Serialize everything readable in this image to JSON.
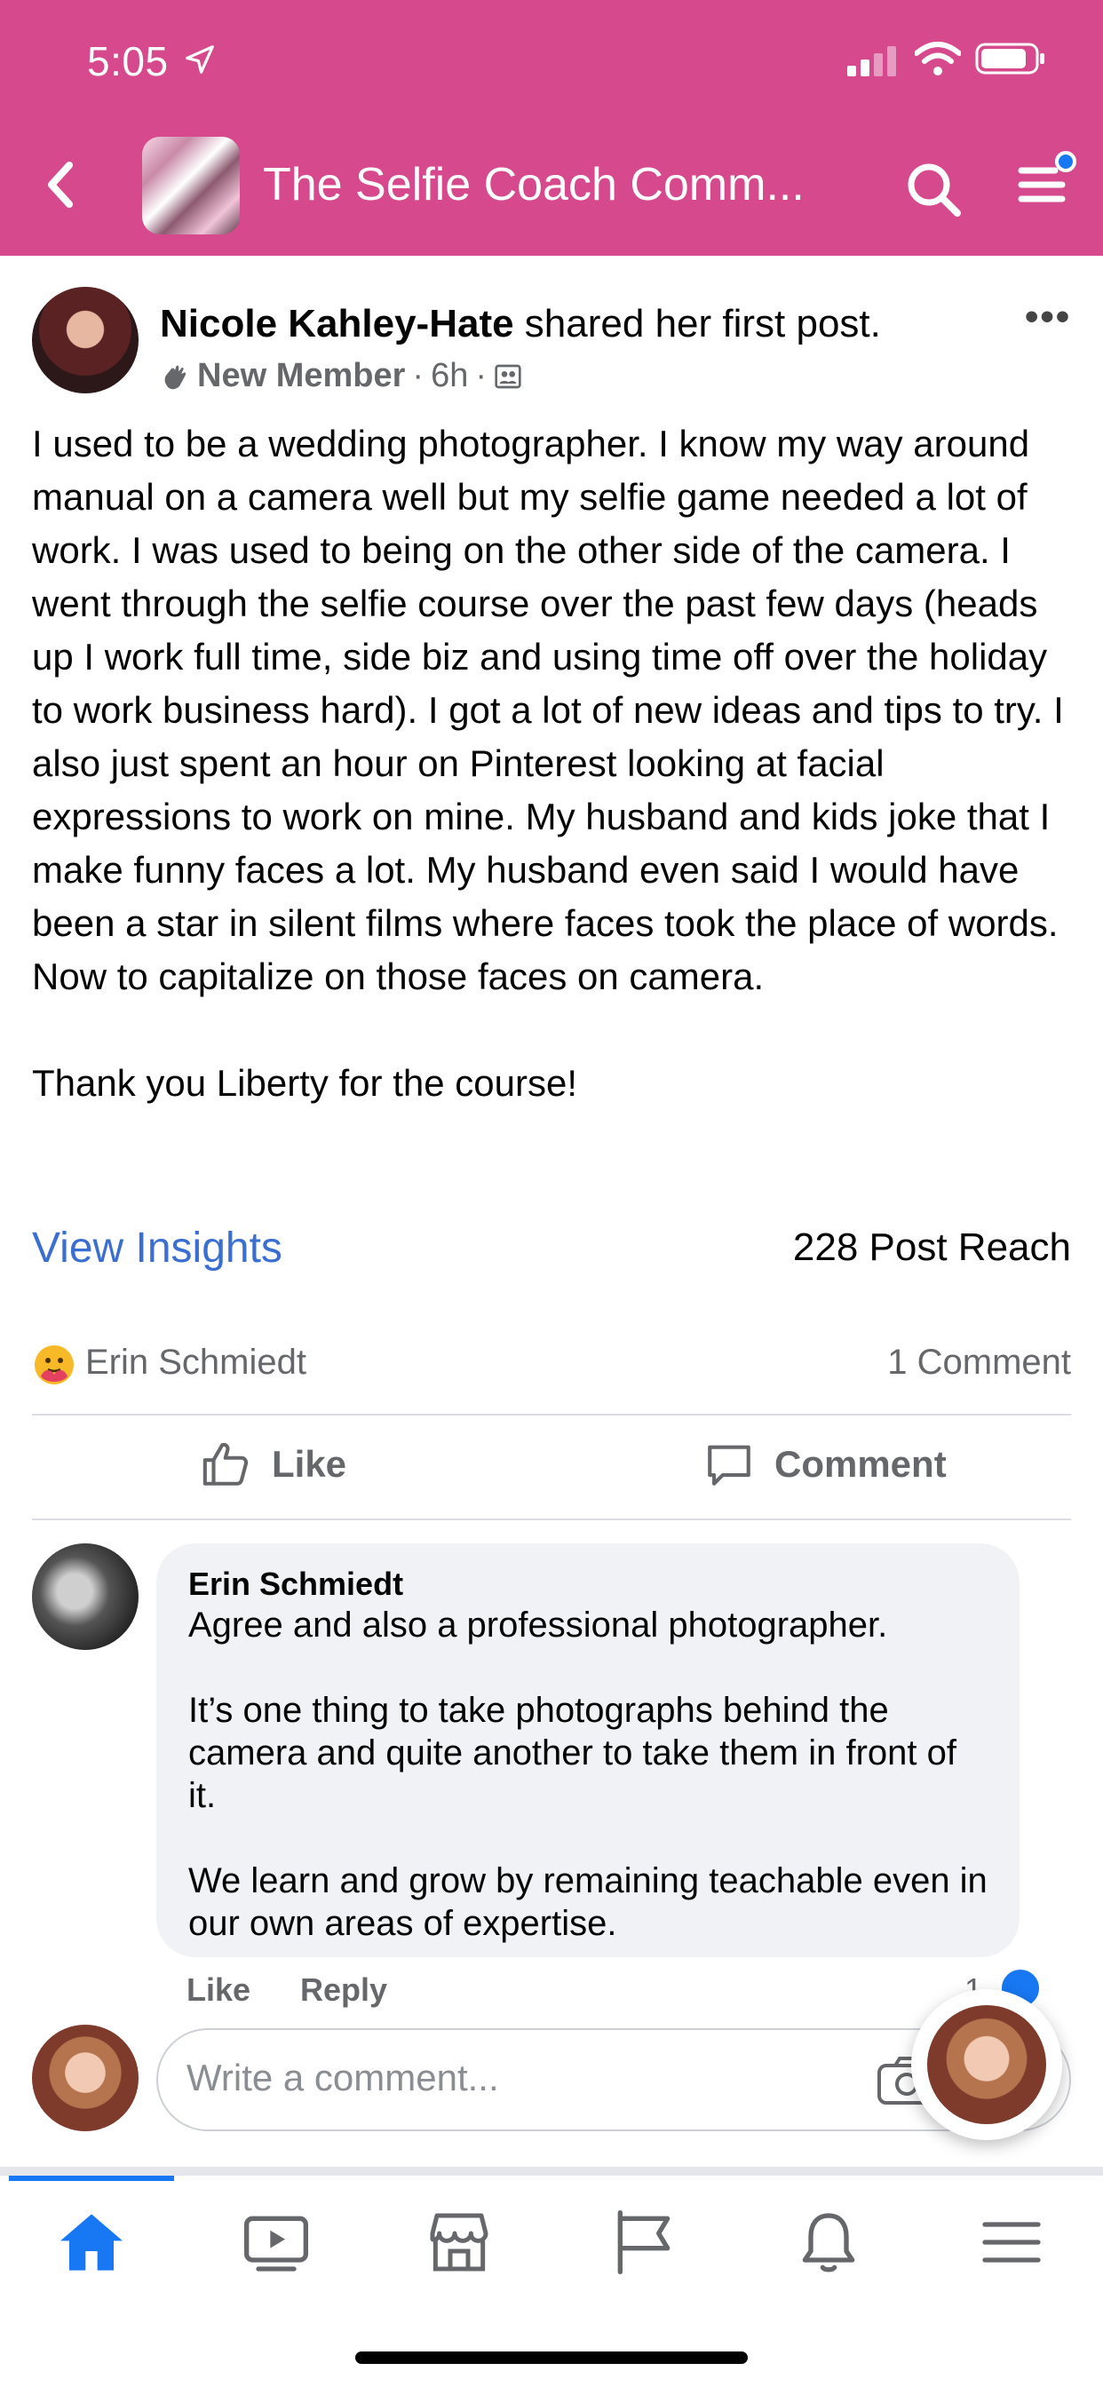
{
  "status_bar": {
    "time": "5:05",
    "icons": [
      "location-arrow-icon",
      "cell-signal-icon",
      "wifi-icon",
      "battery-icon"
    ]
  },
  "header": {
    "title": "The Selfie Coach Comm...",
    "background_color": "#d6498d",
    "icons": [
      "back-chevron-icon",
      "search-icon",
      "menu-icon"
    ]
  },
  "post": {
    "author": "Nicole Kahley-Hate",
    "action": " shared her first post.",
    "badge": "New Member",
    "time": "6h",
    "separator": "·",
    "paragraphs": [
      "I used to be a wedding photographer.  I know my way around manual on a camera well but my selfie game needed a lot of work. I was used to being on the other side of the camera.   I went through the selfie course over the past few days (heads up I work full time, side biz and using time off over the holiday to work business hard). I got a lot of new ideas and tips to try. I also just spent an hour on Pinterest looking at facial expressions to work on mine. My husband and kids joke that I make funny faces a lot. My husband even said I would have been a star in silent films where faces took the place of words. Now to capitalize on those faces on camera.",
      "Thank you Liberty for the course!"
    ],
    "view_insights": "View Insights",
    "post_reach": "228 Post Reach",
    "reactor": "Erin Schmiedt",
    "comment_count": "1 Comment",
    "like_label": "Like",
    "comment_label": "Comment"
  },
  "comment": {
    "author": "Erin Schmiedt",
    "paragraphs": [
      "Agree and also a professional photographer.",
      "It’s one thing to take photographs behind the camera and quite another to take them in front of it.",
      "We learn and grow by remaining teachable even in our own areas of expertise."
    ],
    "like": "Like",
    "reply": "Reply",
    "like_count": "1"
  },
  "composer": {
    "placeholder": "Write a comment..."
  },
  "bottom_nav": {
    "items": [
      "home",
      "watch",
      "marketplace",
      "pages",
      "notifications",
      "menu"
    ],
    "active": "home",
    "accent_color": "#1877f2"
  }
}
